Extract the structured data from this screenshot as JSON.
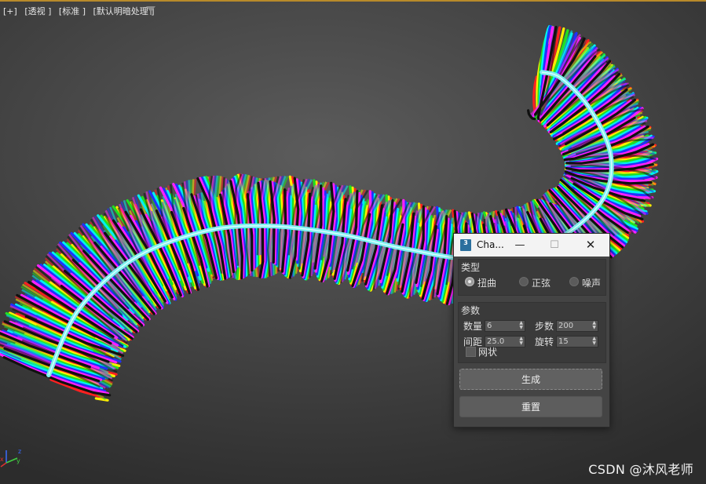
{
  "viewport": {
    "labels": [
      "[+]",
      "[透视 ]",
      "[标准 ]",
      "[默认明暗处理 ]"
    ],
    "filter_icon": "filter-funnel-icon",
    "gizmo_axes": {
      "x": "x",
      "y": "y",
      "z": "z"
    },
    "watermark": "CSDN @沐风老师"
  },
  "dialog": {
    "title": "Cha...",
    "app_icon_text": "3",
    "window_buttons": {
      "minimize": "—",
      "maximize": "☐",
      "close": "✕"
    },
    "type_group": {
      "label": "类型",
      "options": [
        {
          "label": "扭曲",
          "checked": true
        },
        {
          "label": "正弦",
          "checked": false
        },
        {
          "label": "噪声",
          "checked": false
        }
      ]
    },
    "params_group": {
      "label": "参数",
      "count_label": "数量",
      "count_value": "6",
      "steps_label": "步数",
      "steps_value": "200",
      "spacing_label": "间距",
      "spacing_value": "25.0",
      "rotation_label": "旋转",
      "rotation_value": "15",
      "grid_label": "网状",
      "grid_checked": false
    },
    "generate_label": "生成",
    "reset_label": "重置"
  },
  "colors": {
    "accent_line": "#b88a2a",
    "coil_colors": [
      "#ff2020",
      "#ffee00",
      "#20e020",
      "#00f0f0",
      "#2030ff",
      "#ff20ff",
      "#101010"
    ],
    "spine": "#7ff0f0"
  }
}
